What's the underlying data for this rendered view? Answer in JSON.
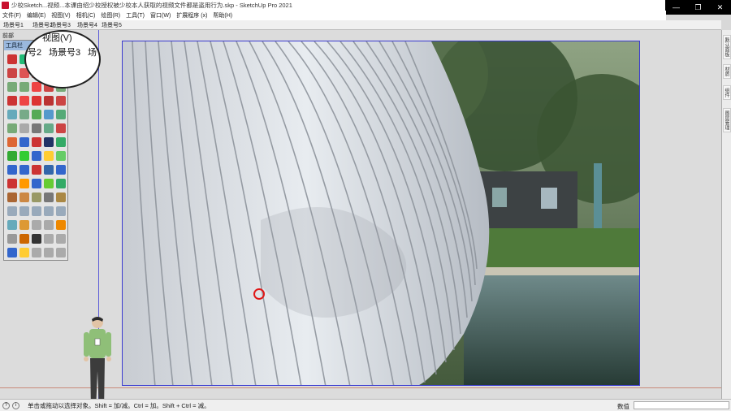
{
  "window": {
    "title": "少校Sketch...视频...本课由绍少校授权被少校本人获取的视频文件都是盗用行为.skp - SketchUp Pro 2021",
    "controls": {
      "minimize": "—",
      "maximize": "❐",
      "close": "✕"
    }
  },
  "menu": [
    "文件(F)",
    "编辑(E)",
    "视图(V)",
    "相机(C)",
    "绘图(R)",
    "工具(T)",
    "窗口(W)",
    "扩展程序 (x)",
    "帮助(H)"
  ],
  "scenes": [
    "场景号1",
    "场景号2",
    "场景号3",
    "场景号4",
    "场景号5"
  ],
  "viewport": {
    "label": "前部"
  },
  "magnifier": {
    "top": "视图(V)",
    "left": "号2",
    "mid": "场景号3",
    "right": "场"
  },
  "toolbox": {
    "title": "工具栏",
    "close": "x",
    "tool_colors": [
      "#c33",
      "#2b7",
      "#c63",
      "#c33",
      "#3a6",
      "#c44",
      "#d55",
      "#c55",
      "#b44",
      "#e66",
      "#7a7",
      "#7a7",
      "#e44",
      "#c44",
      "#7a7",
      "#c33",
      "#e44",
      "#d33",
      "#b33",
      "#c44",
      "#6ab",
      "#7a8",
      "#5a5",
      "#59c",
      "#5a7",
      "#7a7",
      "#aaa",
      "#777",
      "#6a8",
      "#c44",
      "#d63",
      "#36c",
      "#c33",
      "#236",
      "#3a6",
      "#3a3",
      "#3c3",
      "#36c",
      "#fc3",
      "#6c6",
      "#36c",
      "#36c",
      "#c33",
      "#36a",
      "#36c",
      "#c33",
      "#f90",
      "#36c",
      "#6c3",
      "#3a6",
      "#a63",
      "#c84",
      "#996",
      "#777",
      "#a84",
      "#9ab",
      "#9ab",
      "#9ab",
      "#9ab",
      "#9ab",
      "#6ab",
      "#d93",
      "#aaa",
      "#aaa",
      "#e80",
      "#999",
      "#c60",
      "#333",
      "#aaa",
      "#aaa",
      "#36c",
      "#fc3",
      "#aaa",
      "#aaa",
      "#aaa"
    ]
  },
  "right_panel": [
    "默认面板",
    "材质",
    "组件",
    "图层管理"
  ],
  "status": {
    "message": "单击或拖动以选择对象。Shift = 加/减。Ctrl = 加。Shift + Ctrl = 减。",
    "value_label": "数值",
    "value": ""
  },
  "colors": {
    "accent_axis": "#3a3ad0",
    "cursor": "#e01818",
    "title_icon": "#c8102e"
  }
}
